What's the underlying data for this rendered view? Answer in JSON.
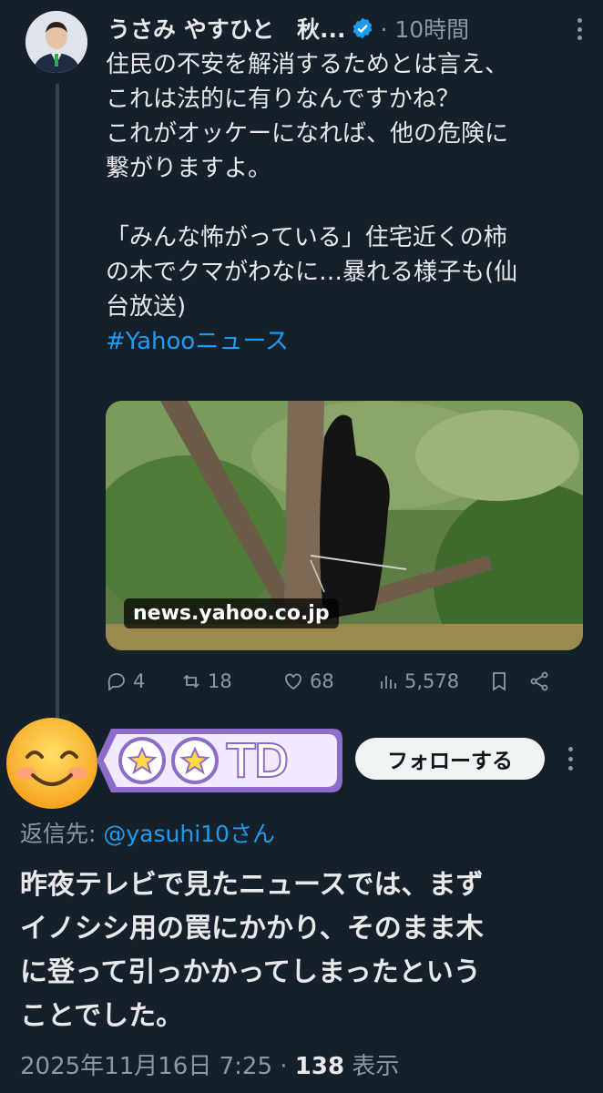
{
  "tweet": {
    "author": "うさみ やすひと　秋...",
    "time": "· 10時間",
    "text_lines": [
      "住民の不安を解消するためとは言え、",
      "これは法的に有りなんですかね？",
      "これがオッケーになれば、他の危険に",
      "繋がりますよ。"
    ],
    "quote_lines": [
      "「みんな怖がっている」住宅近くの柿",
      "の木でクマがわなに…暴れる様子も(仙",
      "台放送)"
    ],
    "hashtag": "#Yahooニュース",
    "card_domain": "news.yahoo.co.jp",
    "stats": {
      "replies": "4",
      "retweets": "18",
      "likes": "68",
      "views": "5,578"
    }
  },
  "reply": {
    "name_tag": "TD",
    "follow_label": "フォローする",
    "reply_to_prefix": "返信先: ",
    "reply_to_handle": "@yasuhi10さん",
    "text_lines": [
      "昨夜テレビで見たニュースでは、まず",
      "イノシシ用の罠にかかり、そのまま木",
      "に登って引っかかってしまったという",
      "ことでした。"
    ],
    "datetime": "2025年11月16日 7:25 · ",
    "views_count": "138",
    "views_label": " 表示"
  },
  "colors": {
    "background": "#15202b",
    "accent": "#1d9bf0",
    "muted": "#8b98a5",
    "tag_purple": "#8e6cc9"
  }
}
